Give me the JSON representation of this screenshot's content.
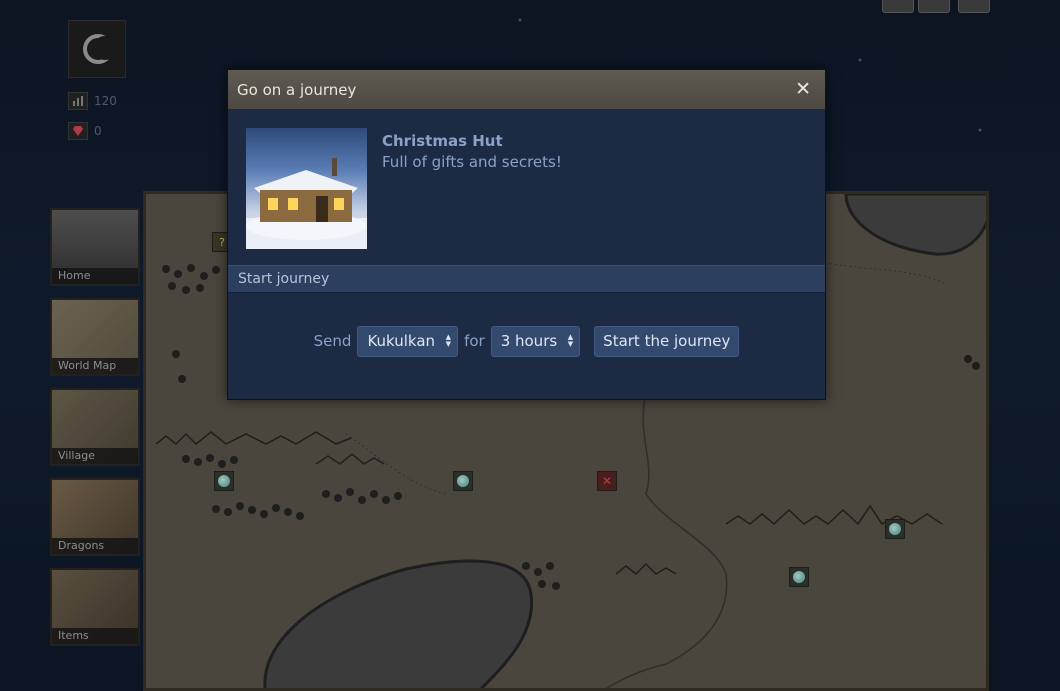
{
  "hud": {
    "stat_1": "120",
    "stat_2": "0"
  },
  "nav": [
    {
      "label": "Home"
    },
    {
      "label": "World Map"
    },
    {
      "label": "Village"
    },
    {
      "label": "Dragons"
    },
    {
      "label": "Items"
    }
  ],
  "dialog": {
    "title": "Go on a journey",
    "close": "✕",
    "location_name": "Christmas Hut",
    "location_desc": "Full of gifts and secrets!",
    "section": "Start journey",
    "send_label": "Send",
    "dragon_selected": "Kukulkan",
    "for_label": "for",
    "duration_selected": "3 hours",
    "start_button": "Start the journey"
  },
  "colors": {
    "dialog_bg": "#1c2a44",
    "dialog_header": "#5f5a52",
    "text_accent": "#8aa1c8",
    "button_bg": "#33496e"
  }
}
